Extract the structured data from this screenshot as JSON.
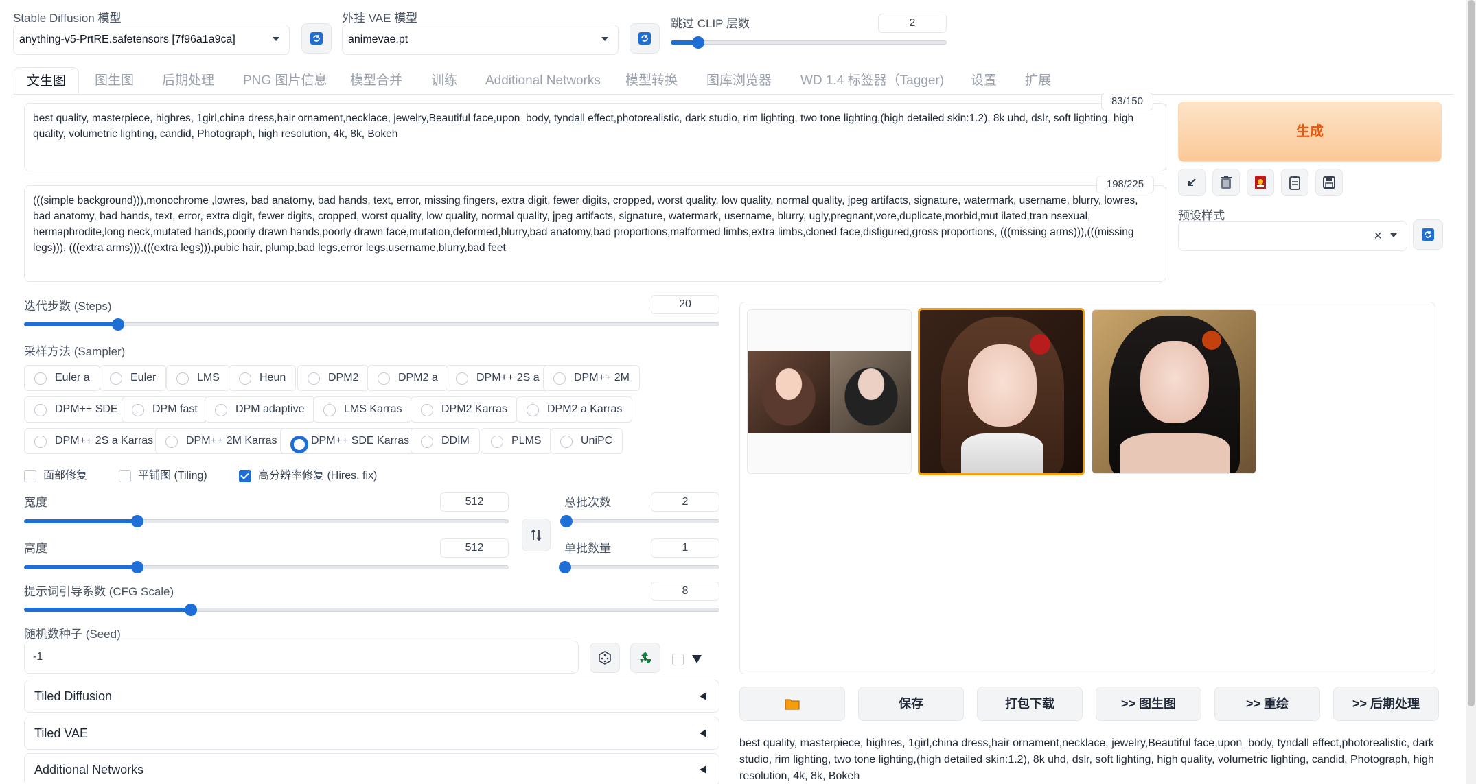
{
  "header": {
    "sd_model_label": "Stable Diffusion 模型",
    "sd_model_value": "anything-v5-PrtRE.safetensors [7f96a1a9ca]",
    "vae_label": "外挂 VAE 模型",
    "vae_value": "animevae.pt",
    "clip_label": "跳过 CLIP 层数",
    "clip_value": "2",
    "clip_fraction": 0.1
  },
  "tabs": [
    {
      "label": "文生图",
      "active": true
    },
    {
      "label": "图生图"
    },
    {
      "label": "后期处理"
    },
    {
      "label": "PNG 图片信息"
    },
    {
      "label": "模型合并"
    },
    {
      "label": "训练"
    },
    {
      "label": "Additional Networks"
    },
    {
      "label": "模型转换"
    },
    {
      "label": "图库浏览器"
    },
    {
      "label": "WD 1.4 标签器（Tagger)"
    },
    {
      "label": "设置"
    },
    {
      "label": "扩展"
    }
  ],
  "prompt": {
    "counter": "83/150",
    "text": "best quality, masterpiece, highres, 1girl,china dress,hair ornament,necklace, jewelry,Beautiful face,upon_body, tyndall effect,photorealistic, dark studio, rim lighting, two tone lighting,(high detailed skin:1.2), 8k uhd, dslr, soft lighting, high quality, volumetric lighting, candid, Photograph, high resolution, 4k, 8k, Bokeh"
  },
  "negative_prompt": {
    "counter": "198/225",
    "text": "(((simple background))),monochrome ,lowres, bad anatomy, bad hands, text, error, missing fingers, extra digit, fewer digits, cropped, worst quality, low quality, normal quality, jpeg artifacts, signature, watermark, username, blurry, lowres, bad anatomy, bad hands, text, error, extra digit, fewer digits, cropped, worst quality, low quality, normal quality, jpeg artifacts, signature, watermark, username, blurry, ugly,pregnant,vore,duplicate,morbid,mut ilated,tran nsexual, hermaphrodite,long neck,mutated hands,poorly drawn hands,poorly drawn face,mutation,deformed,blurry,bad anatomy,bad proportions,malformed limbs,extra limbs,cloned face,disfigured,gross proportions, (((missing arms))),(((missing legs))), (((extra arms))),(((extra legs))),pubic hair, plump,bad legs,error legs,username,blurry,bad feet"
  },
  "generate": {
    "label": "生成"
  },
  "styles": {
    "label": "预设样式",
    "clear": "×"
  },
  "steps": {
    "label": "迭代步数 (Steps)",
    "value": "20",
    "fraction": 0.135
  },
  "sampler": {
    "label": "采样方法 (Sampler)",
    "selected": "DPM++ SDE Karras",
    "rows": [
      [
        "Euler a",
        "Euler",
        "LMS",
        "Heun",
        "DPM2",
        "DPM2 a",
        "DPM++ 2S a",
        "DPM++ 2M"
      ],
      [
        "DPM++ SDE",
        "DPM fast",
        "DPM adaptive",
        "LMS Karras",
        "DPM2 Karras",
        "DPM2 a Karras"
      ],
      [
        "DPM++ 2S a Karras",
        "DPM++ 2M Karras",
        "DPM++ SDE Karras",
        "DDIM",
        "PLMS",
        "UniPC"
      ]
    ]
  },
  "options": {
    "restore_faces": {
      "label": "面部修复",
      "checked": false
    },
    "tiling": {
      "label": "平铺图 (Tiling)",
      "checked": false
    },
    "hires_fix": {
      "label": "高分辨率修复 (Hires. fix)",
      "checked": true
    }
  },
  "width": {
    "label": "宽度",
    "value": "512",
    "fraction": 0.234
  },
  "height": {
    "label": "高度",
    "value": "512",
    "fraction": 0.234
  },
  "batch_count": {
    "label": "总批次数",
    "value": "2",
    "fraction": 0.01
  },
  "batch_size": {
    "label": "单批数量",
    "value": "1",
    "fraction": 0.0
  },
  "cfg": {
    "label": "提示词引导系数 (CFG Scale)",
    "value": "8",
    "fraction": 0.24
  },
  "seed": {
    "label": "随机数种子 (Seed)",
    "value": "-1"
  },
  "accordions": [
    "Tiled Diffusion",
    "Tiled VAE",
    "Additional Networks"
  ],
  "actions": [
    "保存",
    "打包下载",
    ">> 图生图",
    ">> 重绘",
    ">> 后期处理"
  ],
  "output_caption": "best quality, masterpiece, highres, 1girl,china dress,hair ornament,necklace, jewelry,Beautiful face,upon_body, tyndall effect,photorealistic, dark studio, rim lighting, two tone lighting,(high detailed skin:1.2), 8k uhd, dslr, soft lighting, high quality, volumetric lighting, candid, Photograph, high resolution, 4k, 8k, Bokeh",
  "colors": {
    "accent": "#1d6fd6",
    "generate_bg": "#fcd9b5",
    "generate_text": "#ea580c",
    "selected_border": "#f59e0b"
  }
}
